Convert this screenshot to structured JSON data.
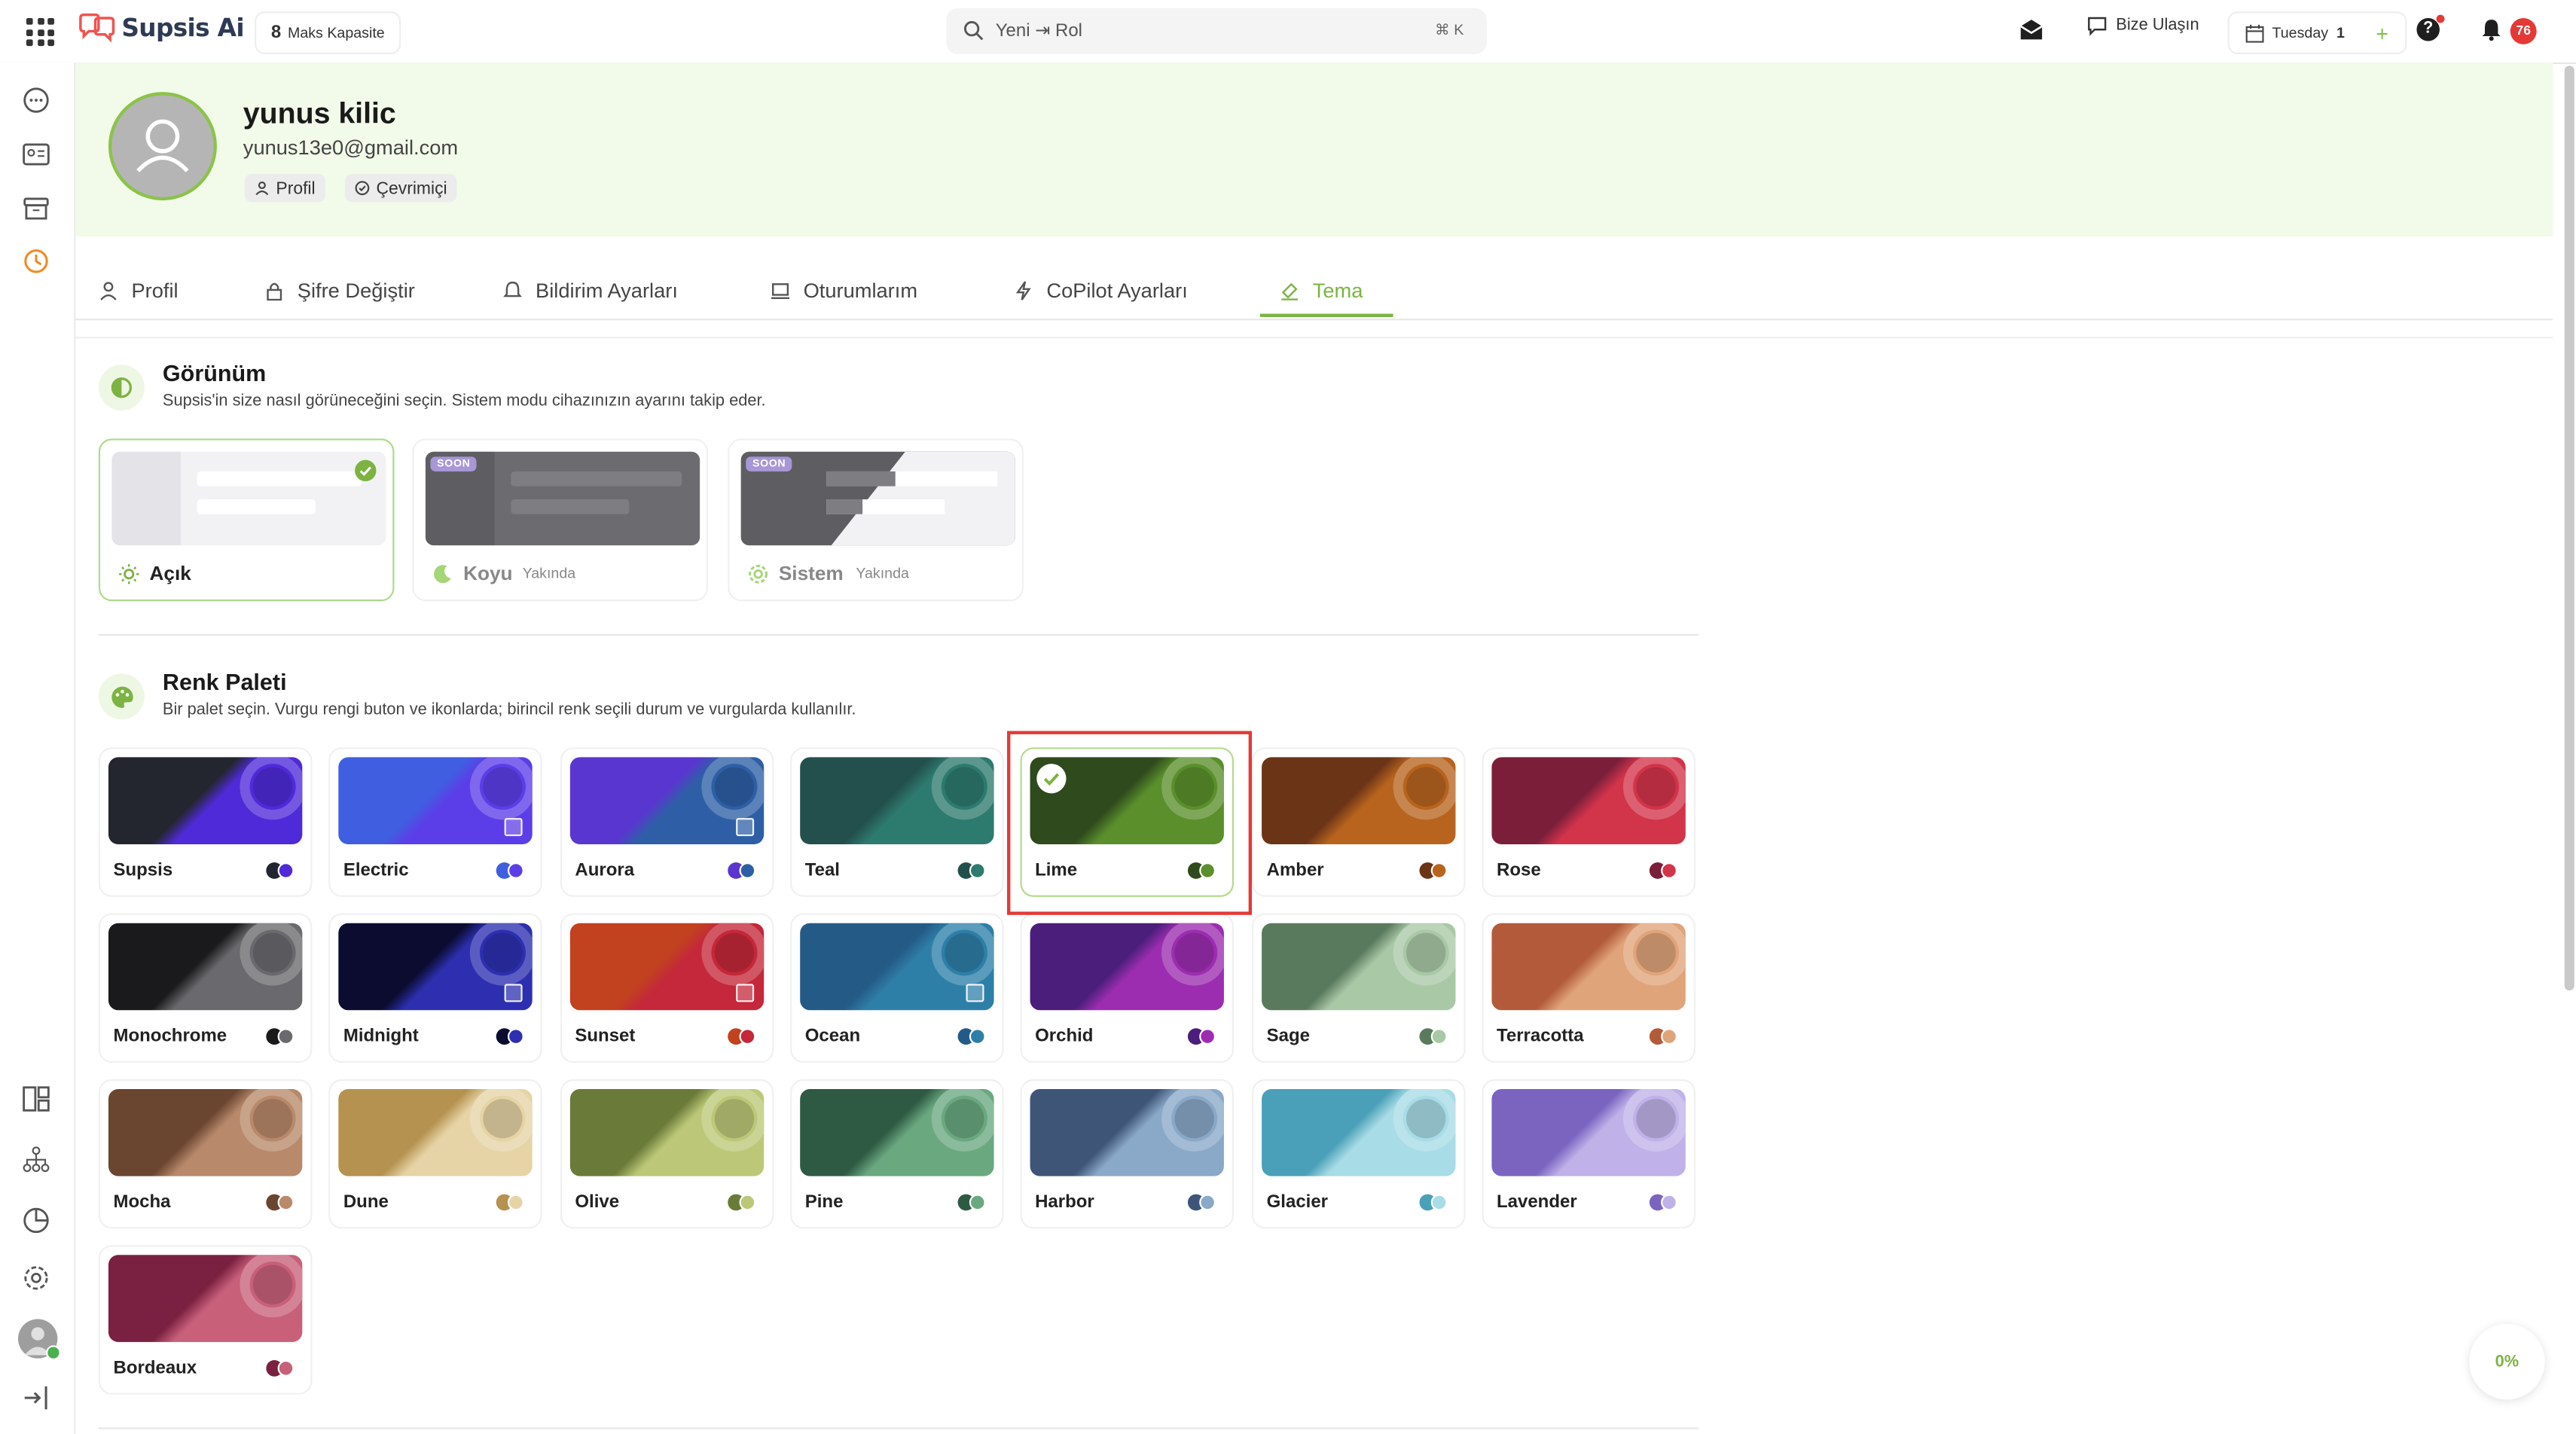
{
  "app": {
    "name": "Supsis Ai",
    "capacity_value": "8",
    "capacity_label": "Maks Kapasite"
  },
  "search": {
    "text": "Yeni ⇥ Rol",
    "shortcut": "⌘ K"
  },
  "header_actions": {
    "contact": "Bize Ulaşın",
    "date_day": "Tuesday",
    "date_num": "1",
    "notification_count": "76"
  },
  "profile": {
    "name": "yunus kilic",
    "email": "yunus13e0@gmail.com",
    "role_badge": "Profil",
    "status_badge": "Çevrimiçi"
  },
  "tabs": [
    {
      "label": "Profil"
    },
    {
      "label": "Şifre Değiştir"
    },
    {
      "label": "Bildirim Ayarları"
    },
    {
      "label": "Oturumlarım"
    },
    {
      "label": "CoPilot Ayarları"
    },
    {
      "label": "Tema"
    }
  ],
  "appearance": {
    "title": "Görünüm",
    "desc": "Supsis'in size nasıl görüneceğini seçin. Sistem modu cihazınızın ayarını takip eder.",
    "soon_tag": "SOON",
    "modes": [
      {
        "label": "Açık",
        "note": ""
      },
      {
        "label": "Koyu",
        "note": "Yakında"
      },
      {
        "label": "Sistem",
        "note": "Yakında"
      }
    ]
  },
  "palette": {
    "title": "Renk Paleti",
    "desc": "Bir palet seçin. Vurgu rengi buton ve ikonlarda; birincil renk seçili durum ve vurgularda kullanılır.",
    "selected": "Lime",
    "items": [
      {
        "name": "Supsis",
        "a": "#23262e",
        "b": "#4f2ad9",
        "grid": false
      },
      {
        "name": "Electric",
        "a": "#3f5fe0",
        "b": "#5c3ee8",
        "grid": true
      },
      {
        "name": "Aurora",
        "a": "#5a36d0",
        "b": "#2e5fa6",
        "grid": true
      },
      {
        "name": "Teal",
        "a": "#23504c",
        "b": "#2d7a6e",
        "grid": false
      },
      {
        "name": "Lime",
        "a": "#2f4a1c",
        "b": "#5a8f2c",
        "grid": false
      },
      {
        "name": "Amber",
        "a": "#6b3416",
        "b": "#b8641e",
        "grid": false
      },
      {
        "name": "Rose",
        "a": "#7a1e3a",
        "b": "#d2344a",
        "grid": false
      },
      {
        "name": "Monochrome",
        "a": "#1a1a1c",
        "b": "#6a6a6e",
        "grid": false
      },
      {
        "name": "Midnight",
        "a": "#0b0c30",
        "b": "#2d2fb0",
        "grid": true
      },
      {
        "name": "Sunset",
        "a": "#c2411e",
        "b": "#c4283a",
        "grid": true
      },
      {
        "name": "Ocean",
        "a": "#245a86",
        "b": "#2e7fa8",
        "grid": true
      },
      {
        "name": "Orchid",
        "a": "#4a1e7a",
        "b": "#9c2db0",
        "grid": false
      },
      {
        "name": "Sage",
        "a": "#5a7a5e",
        "b": "#a9c8a6",
        "grid": false
      },
      {
        "name": "Terracotta",
        "a": "#b25a3a",
        "b": "#e0a47a",
        "grid": false
      },
      {
        "name": "Mocha",
        "a": "#6a4530",
        "b": "#b8896a",
        "grid": false
      },
      {
        "name": "Dune",
        "a": "#b69250",
        "b": "#e6d4a6",
        "grid": false
      },
      {
        "name": "Olive",
        "a": "#6a7a38",
        "b": "#bcc878",
        "grid": false
      },
      {
        "name": "Pine",
        "a": "#2e5a44",
        "b": "#6aa880",
        "grid": false
      },
      {
        "name": "Harbor",
        "a": "#3e5578",
        "b": "#8aa8c8",
        "grid": false
      },
      {
        "name": "Glacier",
        "a": "#4aa0b8",
        "b": "#a8dce6",
        "grid": false
      },
      {
        "name": "Lavender",
        "a": "#7a64c0",
        "b": "#c0b2e8",
        "grid": false
      },
      {
        "name": "Bordeaux",
        "a": "#7a2040",
        "b": "#c8607a",
        "grid": false
      }
    ]
  },
  "progress": {
    "value": "0%"
  },
  "colors": {
    "accent": "#7cb342",
    "highlight": "#e53935"
  }
}
